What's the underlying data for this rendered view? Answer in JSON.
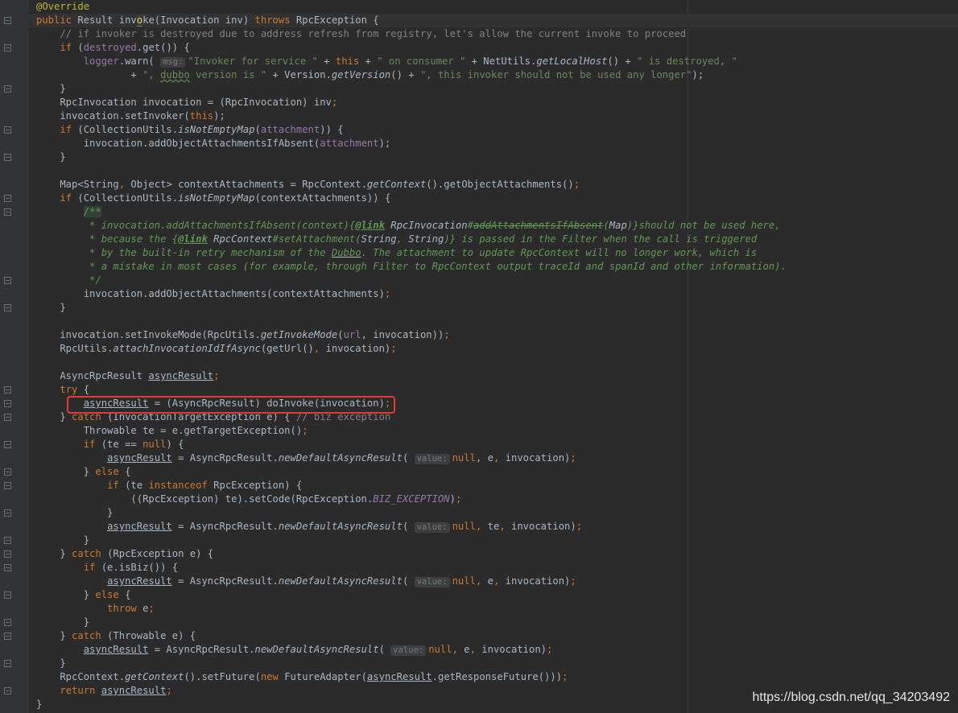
{
  "lines": [
    [
      [
        "@Override",
        "ann"
      ]
    ],
    [
      [
        "public ",
        "kw"
      ],
      [
        "Result ",
        ""
      ],
      [
        "inv",
        ""
      ],
      [
        "o",
        "match"
      ],
      [
        "ke",
        ""
      ],
      [
        "(Invocation inv) ",
        ""
      ],
      [
        "throws ",
        "kw"
      ],
      [
        "RpcException {",
        ""
      ]
    ],
    [
      [
        "    // if invoker is destroyed due to address refresh from registry, let's allow the current invoke to proceed",
        "cmt"
      ]
    ],
    [
      [
        "    ",
        ""
      ],
      [
        "if ",
        "kw"
      ],
      [
        "(",
        ""
      ],
      [
        "destroyed",
        "field"
      ],
      [
        ".get()) {",
        ""
      ]
    ],
    [
      [
        "        logger",
        "field"
      ],
      [
        ".warn( ",
        ""
      ],
      [
        "msg:",
        "hint"
      ],
      [
        "\"Invoker for service \"",
        "str"
      ],
      [
        " + ",
        ""
      ],
      [
        "this",
        "kw"
      ],
      [
        " + ",
        ""
      ],
      [
        "\" on consumer \"",
        "str"
      ],
      [
        " + NetUtils.",
        ""
      ],
      [
        "getLocalHost",
        "it"
      ],
      [
        "() + ",
        ""
      ],
      [
        "\" is destroyed, \"",
        "str"
      ]
    ],
    [
      [
        "                + ",
        ""
      ],
      [
        "\", ",
        "str"
      ],
      [
        "dubbo",
        "str wavy"
      ],
      [
        " version is \"",
        "str"
      ],
      [
        " + Version.",
        ""
      ],
      [
        "getVersion",
        "it"
      ],
      [
        "() + ",
        ""
      ],
      [
        "\", this invoker should not be used any longer\"",
        "str"
      ],
      [
        ");",
        ""
      ]
    ],
    [
      [
        "    }",
        ""
      ]
    ],
    [
      [
        "    RpcInvocation invocation = (RpcInvocation) inv",
        ""
      ],
      [
        ";",
        "kw"
      ]
    ],
    [
      [
        "    invocation.setInvoker(",
        ""
      ],
      [
        "this",
        "kw"
      ],
      [
        ");",
        ""
      ]
    ],
    [
      [
        "    ",
        ""
      ],
      [
        "if ",
        "kw"
      ],
      [
        "(CollectionUtils.",
        ""
      ],
      [
        "isNotEmptyMap",
        "it"
      ],
      [
        "(",
        ""
      ],
      [
        "attachment",
        "field"
      ],
      [
        ")) {",
        ""
      ]
    ],
    [
      [
        "        invocation.addObjectAttachmentsIfAbsent(",
        ""
      ],
      [
        "attachment",
        "field"
      ],
      [
        ");",
        ""
      ]
    ],
    [
      [
        "    }",
        ""
      ]
    ],
    [],
    [
      [
        "    Map<String",
        ""
      ],
      [
        ", ",
        "kw"
      ],
      [
        "Object> contextAttachments = RpcContext.",
        ""
      ],
      [
        "getContext",
        "it"
      ],
      [
        "().getObjectAttachments()",
        ""
      ],
      [
        ";",
        "kw"
      ]
    ],
    [
      [
        "    ",
        ""
      ],
      [
        "if ",
        "kw"
      ],
      [
        "(CollectionUtils.",
        ""
      ],
      [
        "isNotEmptyMap",
        "it"
      ],
      [
        "(contextAttachments)) {",
        ""
      ]
    ],
    [
      [
        "        ",
        ""
      ],
      [
        "/**",
        "doc doc-start"
      ]
    ],
    [
      [
        "         * invocation.addAttachmentsIfAbsent(context)",
        "doc"
      ],
      [
        "{",
        "doc"
      ],
      [
        "@link",
        "doc-tag"
      ],
      [
        " RpcInvocation",
        "doc-code"
      ],
      [
        "#",
        "doc"
      ],
      [
        "addAttachmentsIfAbsent",
        "doc-strike"
      ],
      [
        "(",
        "doc"
      ],
      [
        "Map",
        "doc-code"
      ],
      [
        ")}should not be used here,",
        "doc"
      ]
    ],
    [
      [
        "         * because the ",
        "doc"
      ],
      [
        "{",
        "doc"
      ],
      [
        "@link",
        "doc-tag"
      ],
      [
        " RpcContext",
        "doc-code"
      ],
      [
        "#setAttachment(",
        "doc"
      ],
      [
        "String",
        "doc-code"
      ],
      [
        ", ",
        "doc"
      ],
      [
        "String",
        "doc-code"
      ],
      [
        ")} is passed in the Filter when the call is triggered",
        "doc"
      ]
    ],
    [
      [
        "         * by the built-in retry mechanism of the ",
        "doc"
      ],
      [
        "Dubbo",
        "doc ul"
      ],
      [
        ". The attachment to update RpcContext will no longer work, which is",
        "doc"
      ]
    ],
    [
      [
        "         * a mistake in most cases (for example, through Filter to RpcContext output traceId and spanId and other information).",
        "doc"
      ]
    ],
    [
      [
        "         */",
        "doc"
      ]
    ],
    [
      [
        "        invocation.addObjectAttachments(contextAttachments)",
        ""
      ],
      [
        ";",
        "kw"
      ]
    ],
    [
      [
        "    }",
        ""
      ]
    ],
    [],
    [
      [
        "    invocation.setInvokeMode(RpcUtils.",
        ""
      ],
      [
        "getInvokeMode",
        "it"
      ],
      [
        "(",
        ""
      ],
      [
        "url",
        "field"
      ],
      [
        ", invocation))",
        ""
      ],
      [
        ";",
        "kw"
      ]
    ],
    [
      [
        "    RpcUtils.",
        ""
      ],
      [
        "attachInvocationIdIfAsync",
        "it"
      ],
      [
        "(getUrl()",
        ""
      ],
      [
        ", ",
        "kw"
      ],
      [
        "invocation)",
        ""
      ],
      [
        ";",
        "kw"
      ]
    ],
    [],
    [
      [
        "    AsyncRpcResult ",
        ""
      ],
      [
        "asyncResult",
        "ul"
      ],
      [
        ";",
        "kw"
      ]
    ],
    [
      [
        "    ",
        ""
      ],
      [
        "try ",
        "kw"
      ],
      [
        "{",
        ""
      ]
    ],
    [
      [
        "        ",
        ""
      ],
      [
        "asyncResult",
        "ul"
      ],
      [
        " = (AsyncRpcResult) doInvoke(invocation)",
        ""
      ],
      [
        ";",
        "kw"
      ]
    ],
    [
      [
        "    } ",
        ""
      ],
      [
        "catch ",
        "kw"
      ],
      [
        "(InvocationTargetException e) { ",
        ""
      ],
      [
        "// biz exception",
        "cmt"
      ]
    ],
    [
      [
        "        Throwable te = e.getTargetException()",
        ""
      ],
      [
        ";",
        "kw"
      ]
    ],
    [
      [
        "        ",
        ""
      ],
      [
        "if ",
        "kw"
      ],
      [
        "(te == ",
        ""
      ],
      [
        "null",
        "kw"
      ],
      [
        ") {",
        ""
      ]
    ],
    [
      [
        "            ",
        ""
      ],
      [
        "asyncResult",
        "ul"
      ],
      [
        " = AsyncRpcResult.",
        ""
      ],
      [
        "newDefaultAsyncResult",
        "it"
      ],
      [
        "( ",
        ""
      ],
      [
        "value:",
        "hint"
      ],
      [
        "null",
        "kw"
      ],
      [
        ", ",
        ""
      ],
      [
        "e",
        ""
      ],
      [
        ", ",
        "kw"
      ],
      [
        "invocation)",
        ""
      ],
      [
        ";",
        "kw"
      ]
    ],
    [
      [
        "        } ",
        ""
      ],
      [
        "else ",
        "kw"
      ],
      [
        "{",
        ""
      ]
    ],
    [
      [
        "            ",
        ""
      ],
      [
        "if ",
        "kw"
      ],
      [
        "(te ",
        ""
      ],
      [
        "instanceof ",
        "kw"
      ],
      [
        "RpcException) {",
        ""
      ]
    ],
    [
      [
        "                ((RpcException) te).setCode(RpcException.",
        ""
      ],
      [
        "BIZ_EXCEPTION",
        "static-it"
      ],
      [
        ")",
        ""
      ],
      [
        ";",
        "kw"
      ]
    ],
    [
      [
        "            }",
        ""
      ]
    ],
    [
      [
        "            ",
        ""
      ],
      [
        "asyncResult",
        "ul"
      ],
      [
        " = AsyncRpcResult.",
        ""
      ],
      [
        "newDefaultAsyncResult",
        "it"
      ],
      [
        "( ",
        ""
      ],
      [
        "value:",
        "hint"
      ],
      [
        "null",
        "kw"
      ],
      [
        ", ",
        "kw"
      ],
      [
        "te",
        ""
      ],
      [
        ", ",
        "kw"
      ],
      [
        "invocation)",
        ""
      ],
      [
        ";",
        "kw"
      ]
    ],
    [
      [
        "        }",
        ""
      ]
    ],
    [
      [
        "    } ",
        ""
      ],
      [
        "catch ",
        "kw"
      ],
      [
        "(RpcException e) {",
        ""
      ]
    ],
    [
      [
        "        ",
        ""
      ],
      [
        "if ",
        "kw"
      ],
      [
        "(e.isBiz()) {",
        ""
      ]
    ],
    [
      [
        "            ",
        ""
      ],
      [
        "asyncResult",
        "ul"
      ],
      [
        " = AsyncRpcResult.",
        ""
      ],
      [
        "newDefaultAsyncResult",
        "it"
      ],
      [
        "( ",
        ""
      ],
      [
        "value:",
        "hint"
      ],
      [
        "null",
        "kw"
      ],
      [
        ", ",
        "kw"
      ],
      [
        "e",
        ""
      ],
      [
        ", ",
        "kw"
      ],
      [
        "invocation)",
        ""
      ],
      [
        ";",
        "kw"
      ]
    ],
    [
      [
        "        } ",
        ""
      ],
      [
        "else ",
        "kw"
      ],
      [
        "{",
        ""
      ]
    ],
    [
      [
        "            ",
        ""
      ],
      [
        "throw ",
        "kw"
      ],
      [
        "e",
        ""
      ],
      [
        ";",
        "kw"
      ]
    ],
    [
      [
        "        }",
        ""
      ]
    ],
    [
      [
        "    } ",
        ""
      ],
      [
        "catch ",
        "kw"
      ],
      [
        "(Throwable e) {",
        ""
      ]
    ],
    [
      [
        "        ",
        ""
      ],
      [
        "asyncResult",
        "ul"
      ],
      [
        " = AsyncRpcResult.",
        ""
      ],
      [
        "newDefaultAsyncResult",
        "it"
      ],
      [
        "( ",
        ""
      ],
      [
        "value:",
        "hint"
      ],
      [
        "null",
        "kw"
      ],
      [
        ", ",
        "kw"
      ],
      [
        "e",
        ""
      ],
      [
        ", ",
        "kw"
      ],
      [
        "invocation)",
        ""
      ],
      [
        ";",
        "kw"
      ]
    ],
    [
      [
        "    }",
        ""
      ]
    ],
    [
      [
        "    RpcContext.",
        ""
      ],
      [
        "getContext",
        "it"
      ],
      [
        "().setFuture(",
        ""
      ],
      [
        "new ",
        "kw"
      ],
      [
        "FutureAdapter(",
        ""
      ],
      [
        "asyncResult",
        "ul"
      ],
      [
        ".getResponseFuture()))",
        ""
      ],
      [
        ";",
        "kw"
      ]
    ],
    [
      [
        "    ",
        ""
      ],
      [
        "return ",
        "kw"
      ],
      [
        "asyncResult",
        "ul"
      ],
      [
        ";",
        "kw"
      ]
    ],
    [
      [
        "}",
        ""
      ]
    ]
  ],
  "watermark": "https://blog.csdn.net/qq_34203492"
}
